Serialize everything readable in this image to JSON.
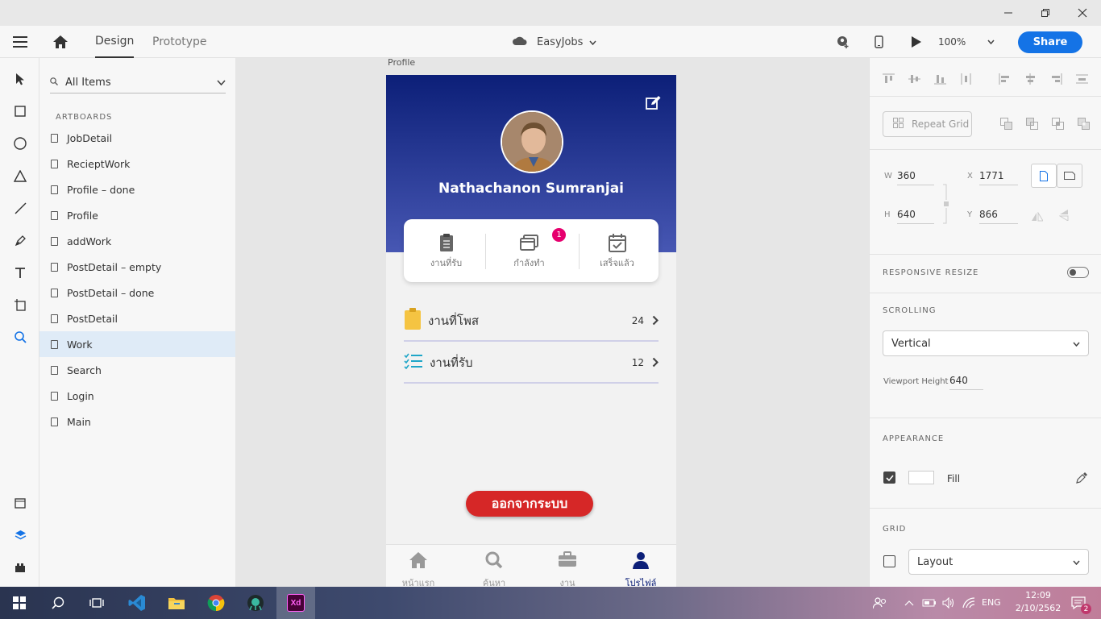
{
  "window": {
    "title": ""
  },
  "toolbar": {
    "tab_design": "Design",
    "tab_prototype": "Prototype",
    "doc_name": "EasyJobs",
    "zoom": "100%",
    "share_label": "Share"
  },
  "layers": {
    "search_placeholder": "All Items",
    "section_title": "ARTBOARDS",
    "items": [
      {
        "label": "JobDetail"
      },
      {
        "label": "RecieptWork"
      },
      {
        "label": "Profile – done"
      },
      {
        "label": "Profile"
      },
      {
        "label": "addWork"
      },
      {
        "label": "PostDetail – empty"
      },
      {
        "label": "PostDetail – done"
      },
      {
        "label": "PostDetail"
      },
      {
        "label": "Work"
      },
      {
        "label": "Search"
      },
      {
        "label": "Login"
      },
      {
        "label": "Main"
      }
    ],
    "selected_index": 8
  },
  "artboard": {
    "label": "Profile"
  },
  "profile": {
    "name": "Nathachanon  Sumranjai",
    "stats": [
      {
        "label": "งานที่รับ"
      },
      {
        "label": "กำลังทำ",
        "badge": "1"
      },
      {
        "label": "เสร็จแล้ว"
      }
    ],
    "rows": [
      {
        "label": "งานที่โพส",
        "count": "24"
      },
      {
        "label": "งานที่รับ",
        "count": "12"
      }
    ],
    "logout": "ออกจากระบบ",
    "nav": [
      {
        "label": "หน้าแรก",
        "icon": "home-icon"
      },
      {
        "label": "ค้นหา",
        "icon": "search-icon"
      },
      {
        "label": "งาน",
        "icon": "briefcase-icon"
      },
      {
        "label": "โปรไฟล์",
        "icon": "user-icon"
      }
    ]
  },
  "props": {
    "repeat_grid": "Repeat Grid",
    "w_label": "W",
    "w": "360",
    "x_label": "X",
    "x": "1771",
    "h_label": "H",
    "h": "640",
    "y_label": "Y",
    "y": "866",
    "responsive_resize": "RESPONSIVE RESIZE",
    "scrolling": "SCROLLING",
    "scrolling_value": "Vertical",
    "viewport_label": "Viewport Height",
    "viewport_value": "640",
    "appearance": "APPEARANCE",
    "fill_label": "Fill",
    "grid": "GRID",
    "grid_value": "Layout"
  },
  "taskbar": {
    "lang": "ENG",
    "time": "12:09",
    "date": "2/10/2562",
    "notif_count": "2"
  },
  "colors": {
    "accent": "#1473e6",
    "hero_top": "#0c1f78",
    "hero_bottom": "#4757b3",
    "logout": "#d62727",
    "badge": "#e6006e",
    "nav_active": "#0c1f78"
  }
}
